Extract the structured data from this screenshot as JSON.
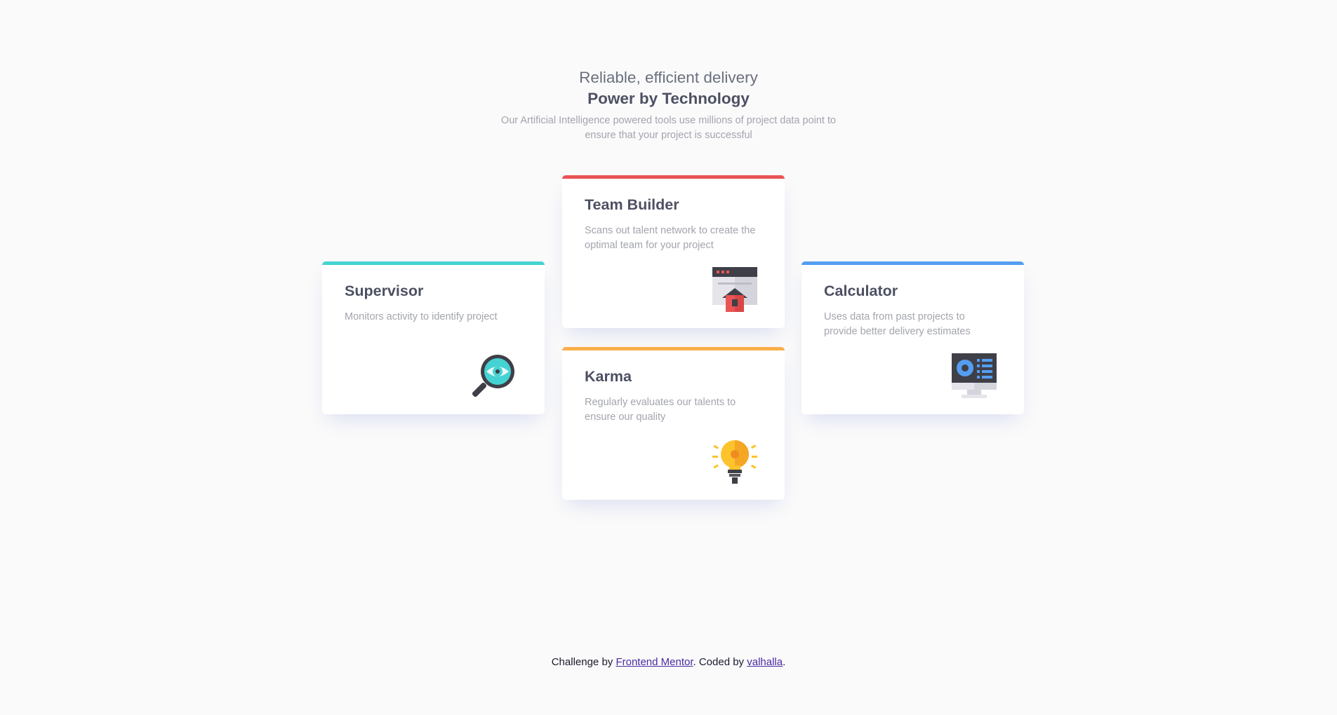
{
  "header": {
    "tagline": "Reliable, efficient delivery",
    "title": "Power by Technology",
    "intro": "Our Artificial Intelligence powered tools use millions of project data point to ensure that your project is successful"
  },
  "cards": [
    {
      "title": "Supervisor",
      "description": "Monitors activity to identify project",
      "accent_color": "#44d3d2",
      "icon": "magnifier-eye-icon"
    },
    {
      "title": "Team Builder",
      "description": "Scans out talent network to create the optimal team for your project",
      "accent_color": "#ea5454",
      "icon": "browser-house-icon"
    },
    {
      "title": "Karma",
      "description": "Regularly evaluates our talents to ensure our quality",
      "accent_color": "#fcaf4a",
      "icon": "lightbulb-icon"
    },
    {
      "title": "Calculator",
      "description": "Uses data from past projects to provide better delivery estimates",
      "accent_color": "#549ef2",
      "icon": "monitor-chart-icon"
    }
  ],
  "footer": {
    "prefix": "Challenge by ",
    "link1": "Frontend Mentor",
    "middle": ". Coded by ",
    "link2": "valhalla",
    "suffix": "."
  }
}
